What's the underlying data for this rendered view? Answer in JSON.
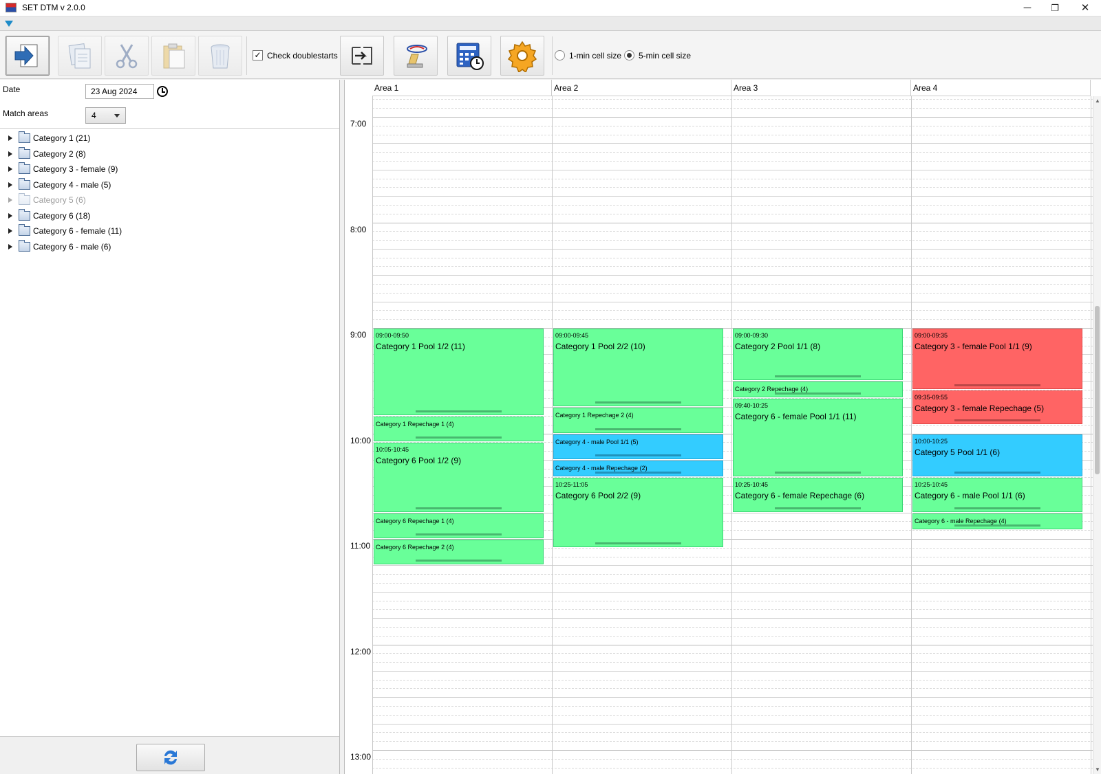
{
  "window": {
    "title": "SET DTM v 2.0.0",
    "minimize_glyph": "─",
    "maximize_glyph": "❐",
    "close_glyph": "✕"
  },
  "toolbar": {
    "check_doublestarts_label": "Check doublestarts",
    "check_doublestarts_checked": true,
    "check_mark": "✓",
    "cell_size_1min_label": "1-min cell size",
    "cell_size_5min_label": "5-min cell size",
    "cell_size_selected": "5-min",
    "buttons": [
      {
        "icon": "export-arrow-icon",
        "enabled": true
      },
      {
        "icon": "copy-icon",
        "enabled": false
      },
      {
        "icon": "cut-icon",
        "enabled": false
      },
      {
        "icon": "paste-icon",
        "enabled": false
      },
      {
        "icon": "delete-icon",
        "enabled": false
      },
      {
        "icon": "swap-icon",
        "enabled": true
      },
      {
        "icon": "import-icon",
        "enabled": true
      },
      {
        "icon": "calculator-clock-icon",
        "enabled": true
      },
      {
        "icon": "settings-gear-icon",
        "enabled": true
      }
    ]
  },
  "left": {
    "date_label": "Date",
    "date_value": "23 Aug 2024",
    "match_areas_label": "Match areas",
    "match_areas_value": "4",
    "categories": [
      {
        "label": "Category 1 (21)",
        "enabled": true
      },
      {
        "label": "Category 2 (8)",
        "enabled": true
      },
      {
        "label": "Category 3 - female (9)",
        "enabled": true
      },
      {
        "label": "Category 4 - male (5)",
        "enabled": true
      },
      {
        "label": "Category 5 (6)",
        "enabled": false
      },
      {
        "label": "Category 6 (18)",
        "enabled": true
      },
      {
        "label": "Category 6 - female (11)",
        "enabled": true
      },
      {
        "label": "Category 6 - male (6)",
        "enabled": true
      }
    ]
  },
  "schedule": {
    "areas": [
      "Area 1",
      "Area 2",
      "Area 3",
      "Area 4"
    ],
    "hours": [
      "7:00",
      "8:00",
      "9:00",
      "10:00",
      "11:00",
      "12:00",
      "13:00"
    ],
    "blocks": [
      {
        "area": 0,
        "start": "09:00",
        "end": "09:50",
        "time": "09:00-09:50",
        "name": "Category 1 Pool 1/2 (11)",
        "color": "green",
        "small": false
      },
      {
        "area": 0,
        "start": "09:50",
        "end": "10:05",
        "time": "",
        "name": "Category 1 Repechage 1 (4)",
        "color": "green",
        "small": true
      },
      {
        "area": 0,
        "start": "10:05",
        "end": "10:45",
        "time": "10:05-10:45",
        "name": "Category 6 Pool 1/2 (9)",
        "color": "green",
        "small": false
      },
      {
        "area": 0,
        "start": "10:45",
        "end": "11:00",
        "time": "",
        "name": "Category 6 Repechage 1 (4)",
        "color": "green",
        "small": true
      },
      {
        "area": 0,
        "start": "11:00",
        "end": "11:15",
        "time": "",
        "name": "Category 6 Repechage 2 (4)",
        "color": "green",
        "small": true
      },
      {
        "area": 1,
        "start": "09:00",
        "end": "09:45",
        "time": "09:00-09:45",
        "name": "Category 1 Pool 2/2 (10)",
        "color": "green",
        "small": false
      },
      {
        "area": 1,
        "start": "09:45",
        "end": "10:00",
        "time": "",
        "name": "Category 1 Repechage 2 (4)",
        "color": "green",
        "small": true
      },
      {
        "area": 1,
        "start": "10:00",
        "end": "10:15",
        "time": "",
        "name": "Category 4 - male Pool 1/1 (5)",
        "color": "blue",
        "small": true
      },
      {
        "area": 1,
        "start": "10:15",
        "end": "10:25",
        "time": "",
        "name": "Category 4 - male Repechage (2)",
        "color": "blue",
        "small": true
      },
      {
        "area": 1,
        "start": "10:25",
        "end": "11:05",
        "time": "10:25-11:05",
        "name": "Category 6 Pool 2/2 (9)",
        "color": "green",
        "small": false
      },
      {
        "area": 2,
        "start": "09:00",
        "end": "09:30",
        "time": "09:00-09:30",
        "name": "Category 2 Pool 1/1 (8)",
        "color": "green",
        "small": false
      },
      {
        "area": 2,
        "start": "09:30",
        "end": "09:40",
        "time": "",
        "name": "Category 2 Repechage (4)",
        "color": "green",
        "small": true
      },
      {
        "area": 2,
        "start": "09:40",
        "end": "10:25",
        "time": "09:40-10:25",
        "name": "Category 6 - female Pool 1/1 (11)",
        "color": "green",
        "small": false
      },
      {
        "area": 2,
        "start": "10:25",
        "end": "10:45",
        "time": "10:25-10:45",
        "name": "Category 6 - female Repechage (6)",
        "color": "green",
        "small": false
      },
      {
        "area": 3,
        "start": "09:00",
        "end": "09:35",
        "time": "09:00-09:35",
        "name": "Category 3 - female Pool 1/1 (9)",
        "color": "red",
        "small": false
      },
      {
        "area": 3,
        "start": "09:35",
        "end": "09:55",
        "time": "09:35-09:55",
        "name": "Category 3 - female Repechage (5)",
        "color": "red",
        "small": false
      },
      {
        "area": 3,
        "start": "10:00",
        "end": "10:25",
        "time": "10:00-10:25",
        "name": "Category 5 Pool 1/1 (6)",
        "color": "blue",
        "small": false
      },
      {
        "area": 3,
        "start": "10:25",
        "end": "10:45",
        "time": "10:25-10:45",
        "name": "Category 6 - male Pool 1/1 (6)",
        "color": "green",
        "small": false
      },
      {
        "area": 3,
        "start": "10:45",
        "end": "10:55",
        "time": "",
        "name": "Category 6 - male Repechage (4)",
        "color": "green",
        "small": true
      }
    ]
  }
}
